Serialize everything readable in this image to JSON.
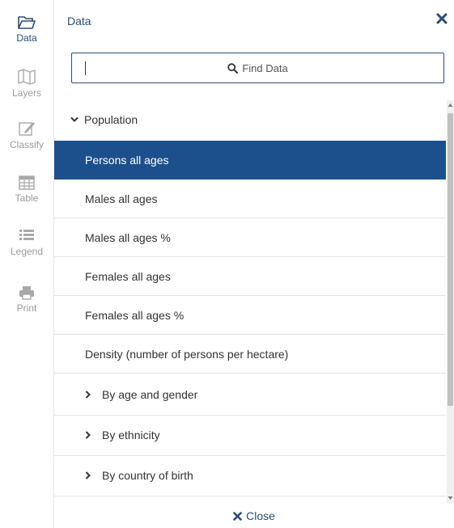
{
  "rail": {
    "items": [
      {
        "label": "Data",
        "icon": "folder-open-icon",
        "active": true
      },
      {
        "label": "Layers",
        "icon": "map-icon",
        "active": false
      },
      {
        "label": "Classify",
        "icon": "edit-icon",
        "active": false
      },
      {
        "label": "Table",
        "icon": "table-icon",
        "active": false
      },
      {
        "label": "Legend",
        "icon": "list-icon",
        "active": false
      },
      {
        "label": "Print",
        "icon": "printer-icon",
        "active": false
      }
    ]
  },
  "panel": {
    "title": "Data",
    "search": {
      "placeholder": "Find Data",
      "value": ""
    },
    "group": {
      "label": "Population",
      "expanded": true,
      "items": [
        {
          "label": "Persons all ages",
          "selected": true
        },
        {
          "label": "Males all ages",
          "selected": false
        },
        {
          "label": "Males all ages %",
          "selected": false
        },
        {
          "label": "Females all ages",
          "selected": false
        },
        {
          "label": "Females all ages %",
          "selected": false
        },
        {
          "label": "Density (number of persons per hectare)",
          "selected": false
        }
      ],
      "subgroups": [
        {
          "label": "By age and gender",
          "expanded": false
        },
        {
          "label": "By ethnicity",
          "expanded": false
        },
        {
          "label": "By country of birth",
          "expanded": false
        }
      ]
    },
    "close_label": "Close"
  },
  "colors": {
    "accent": "#2a4d7a",
    "selected_bg": "#1c508d",
    "inactive_icon": "#9a9a9a"
  }
}
